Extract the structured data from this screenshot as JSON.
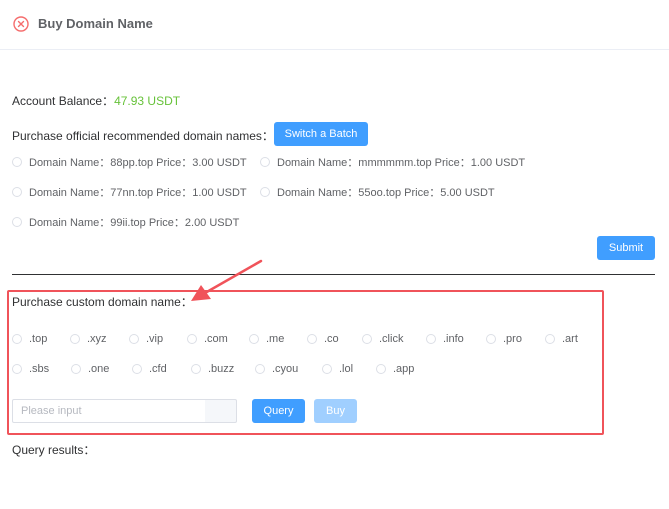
{
  "header": {
    "title": "Buy Domain Name",
    "close_icon": "close-circle-icon",
    "accent": "#f56c6c"
  },
  "balance": {
    "label": "Account Balance：",
    "value": "47.93 USDT",
    "value_color": "#67c23a"
  },
  "official": {
    "label": "Purchase official recommended domain names：",
    "batch_button": "Switch a Batch",
    "options": [
      "Domain Name：88pp.top Price：3.00 USDT",
      "Domain Name：mmmmmm.top Price：1.00 USDT",
      "Domain Name：77nn.top Price：1.00 USDT",
      "Domain Name：55oo.top Price：5.00 USDT",
      "Domain Name：99ii.top Price：2.00 USDT"
    ],
    "submit_button": "Submit"
  },
  "custom": {
    "label": "Purchase custom domain name：",
    "tlds": [
      ".top",
      ".xyz",
      ".vip",
      ".com",
      ".me",
      ".co",
      ".click",
      ".info",
      ".pro",
      ".art",
      ".sbs",
      ".one",
      ".cfd",
      ".buzz",
      ".cyou",
      ".lol",
      ".app"
    ],
    "input_placeholder": "Please input",
    "query_button": "Query",
    "buy_button": "Buy"
  },
  "results": {
    "label": "Query results："
  },
  "annotation": {
    "arrow_color": "#f0535a",
    "box_color": "#f0535a"
  },
  "colors": {
    "primary": "#409eff",
    "primary_disabled": "#a0cfff"
  }
}
